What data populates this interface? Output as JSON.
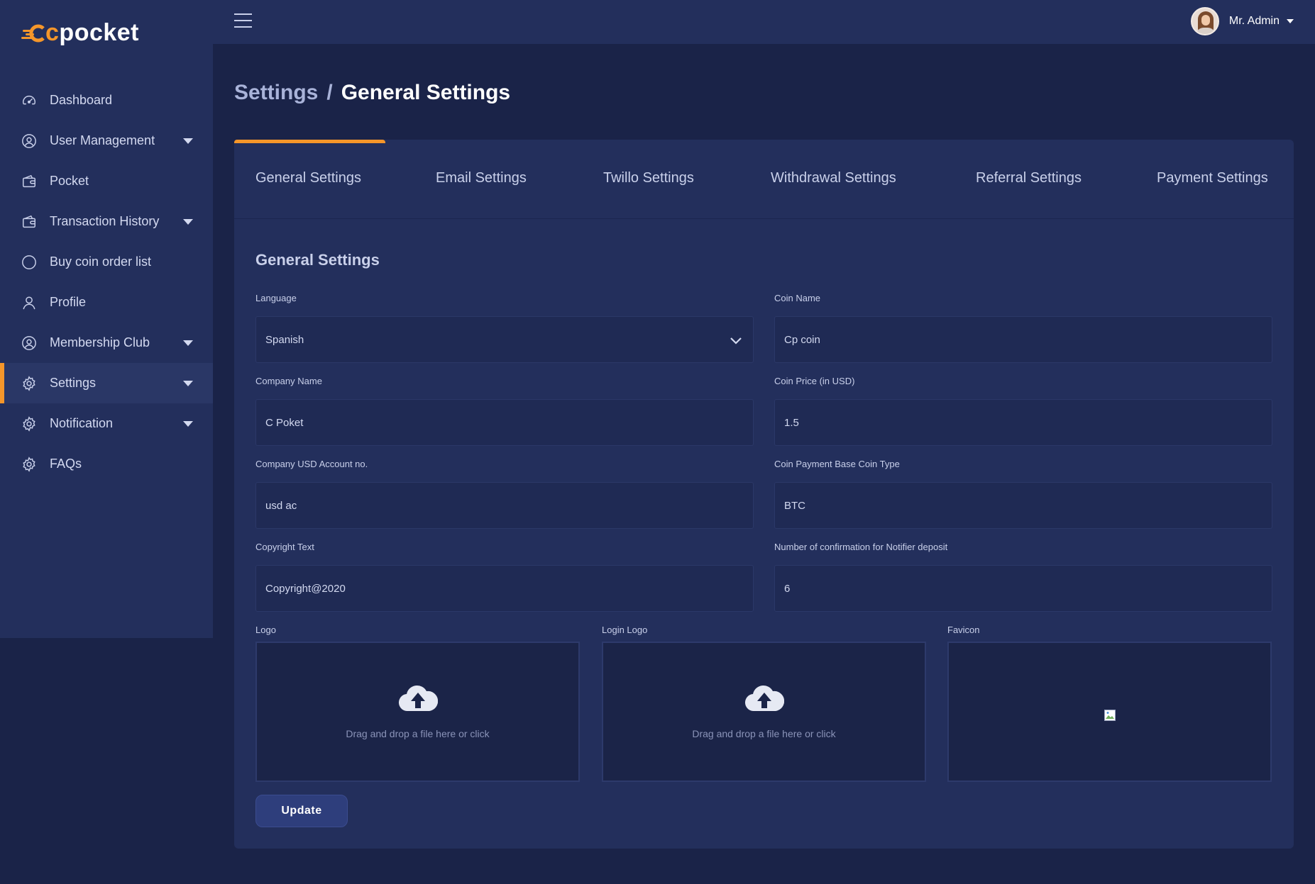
{
  "brand": {
    "name_prefix": "c",
    "name_rest": "pocket",
    "accent": "#f5962a"
  },
  "sidebar": {
    "items": [
      {
        "label": "Dashboard",
        "icon": "gauge-icon",
        "has_caret": false
      },
      {
        "label": "User Management",
        "icon": "user-circle-icon",
        "has_caret": true
      },
      {
        "label": "Pocket",
        "icon": "wallet-icon",
        "has_caret": false
      },
      {
        "label": "Transaction History",
        "icon": "wallet-icon",
        "has_caret": true
      },
      {
        "label": "Buy coin order list",
        "icon": "circle-icon",
        "has_caret": false
      },
      {
        "label": "Profile",
        "icon": "user-icon",
        "has_caret": false
      },
      {
        "label": "Membership Club",
        "icon": "user-circle-icon",
        "has_caret": true
      },
      {
        "label": "Settings",
        "icon": "gear-icon",
        "has_caret": true,
        "active": true
      },
      {
        "label": "Notification",
        "icon": "gear-icon",
        "has_caret": true
      },
      {
        "label": "FAQs",
        "icon": "gear-icon",
        "has_caret": false
      }
    ]
  },
  "topbar": {
    "user_name": "Mr. Admin"
  },
  "breadcrumb": {
    "parent": "Settings",
    "separator": "/",
    "current": "General Settings"
  },
  "tabs": [
    {
      "label": "General Settings",
      "active": true
    },
    {
      "label": "Email Settings"
    },
    {
      "label": "Twillo Settings"
    },
    {
      "label": "Withdrawal Settings"
    },
    {
      "label": "Referral Settings"
    },
    {
      "label": "Payment Settings"
    }
  ],
  "form": {
    "title": "General Settings",
    "language": {
      "label": "Language",
      "value": "Spanish"
    },
    "coin_name": {
      "label": "Coin Name",
      "value": "Cp coin"
    },
    "company_name": {
      "label": "Company Name",
      "value": "C Poket"
    },
    "coin_price": {
      "label": "Coin Price (in USD)",
      "value": "1.5"
    },
    "usd_account": {
      "label": "Company USD Account no.",
      "value": "usd ac"
    },
    "base_coin_type": {
      "label": "Coin Payment Base Coin Type",
      "value": "BTC"
    },
    "copyright": {
      "label": "Copyright Text",
      "value": "Copyright@2020"
    },
    "confirmations": {
      "label": "Number of confirmation for Notifier deposit",
      "value": "6"
    },
    "logo": {
      "label": "Logo",
      "message": "Drag and drop a file here or click"
    },
    "login_logo": {
      "label": "Login Logo",
      "message": "Drag and drop a file here or click"
    },
    "favicon": {
      "label": "Favicon"
    },
    "submit_label": "Update"
  }
}
